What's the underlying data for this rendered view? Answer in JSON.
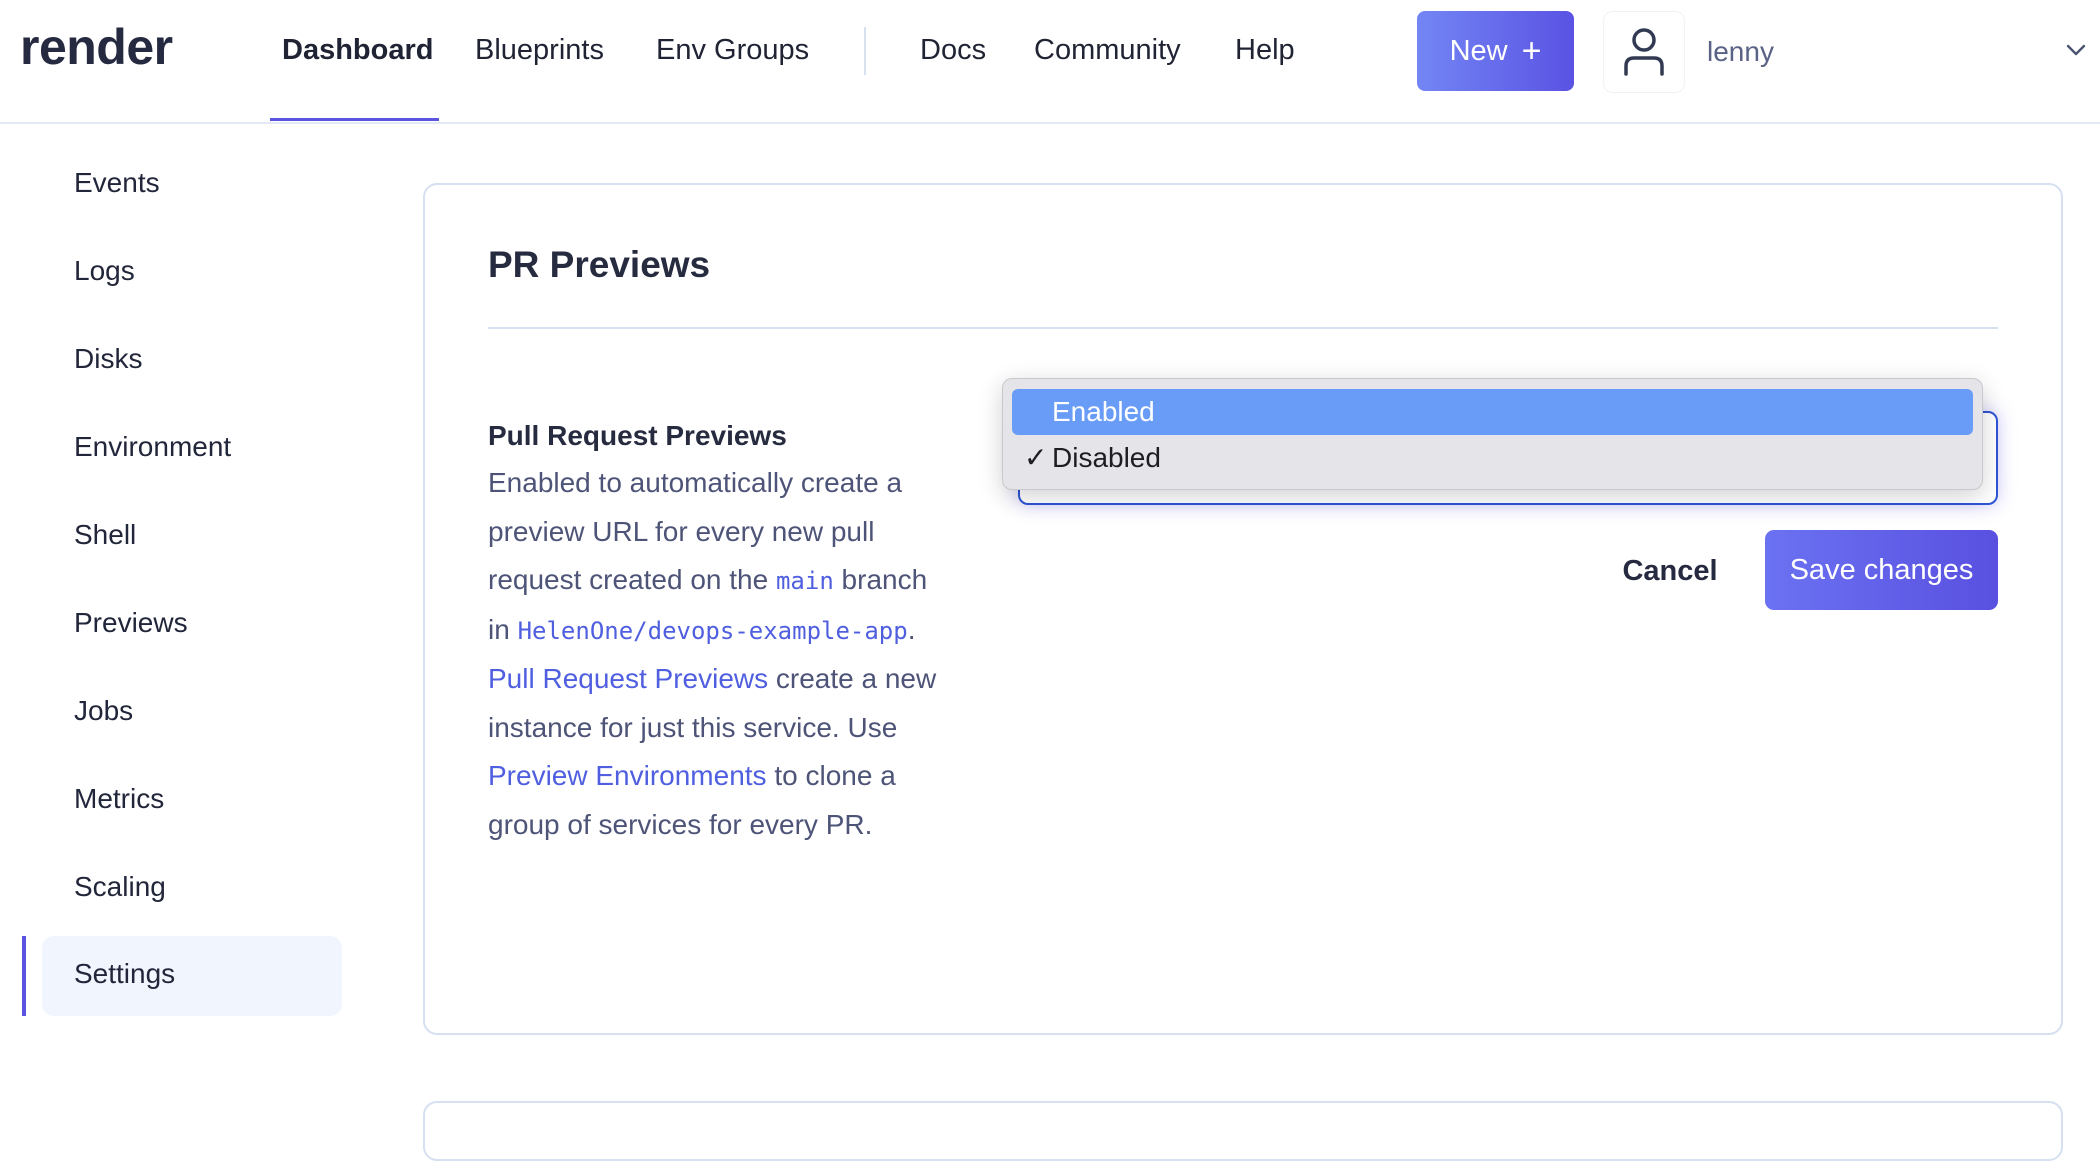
{
  "header": {
    "logo": "render",
    "nav": [
      {
        "label": "Dashboard",
        "active": true
      },
      {
        "label": "Blueprints",
        "active": false
      },
      {
        "label": "Env Groups",
        "active": false
      },
      {
        "label": "Docs",
        "active": false
      },
      {
        "label": "Community",
        "active": false
      },
      {
        "label": "Help",
        "active": false
      }
    ],
    "new_button": {
      "label": "New",
      "icon": "plus-icon"
    },
    "user": {
      "name": "lenny",
      "avatar_icon": "user-icon",
      "menu_icon": "chevron-down-icon"
    }
  },
  "sidebar": {
    "items": [
      {
        "label": "Events"
      },
      {
        "label": "Logs"
      },
      {
        "label": "Disks"
      },
      {
        "label": "Environment"
      },
      {
        "label": "Shell"
      },
      {
        "label": "Previews"
      },
      {
        "label": "Jobs"
      },
      {
        "label": "Metrics"
      },
      {
        "label": "Scaling"
      },
      {
        "label": "Settings",
        "active": true
      }
    ]
  },
  "card": {
    "title": "PR Previews",
    "field": {
      "label": "Pull Request Previews",
      "desc": {
        "t1": "Enabled to automatically create a preview URL for every new pull request created on the ",
        "branch": "main",
        "t2": " branch in ",
        "repo": "HelenOne/devops-example-app",
        "t3": ". ",
        "link1": "Pull Request Previews",
        "t4": " create a new instance for just this service. Use ",
        "link2": "Preview Environments",
        "t5": " to clone a group of services for every PR."
      },
      "select": {
        "current_value": "Disabled",
        "options": [
          {
            "label": "Enabled",
            "highlighted": true,
            "checked": false
          },
          {
            "label": "Disabled",
            "highlighted": false,
            "checked": true
          }
        ],
        "check_glyph": "✓"
      }
    },
    "cancel_label": "Cancel",
    "save_label": "Save changes"
  },
  "colors": {
    "accent": "#5a54e0",
    "link": "#4f5fe0",
    "option_highlight": "#699cf6",
    "active_sidebar_bg": "#f1f5fe"
  }
}
